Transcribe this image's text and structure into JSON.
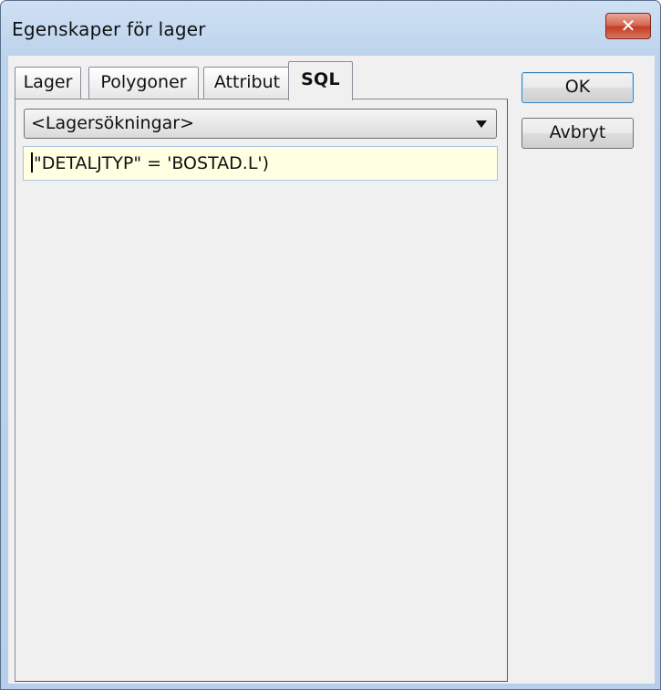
{
  "window": {
    "title": "Egenskaper för lager",
    "close_label": "✕"
  },
  "tabs": [
    {
      "label": "Lager",
      "active": false
    },
    {
      "label": "Polygoner",
      "active": false
    },
    {
      "label": "Attribut",
      "active": false
    },
    {
      "label": "SQL",
      "active": true
    }
  ],
  "sql_tab": {
    "query_select_value": "<Lagersökningar>",
    "query_text": "\"DETALJTYP\" = 'BOSTAD.L')"
  },
  "buttons": {
    "ok_label": "OK",
    "cancel_label": "Avbryt"
  }
}
